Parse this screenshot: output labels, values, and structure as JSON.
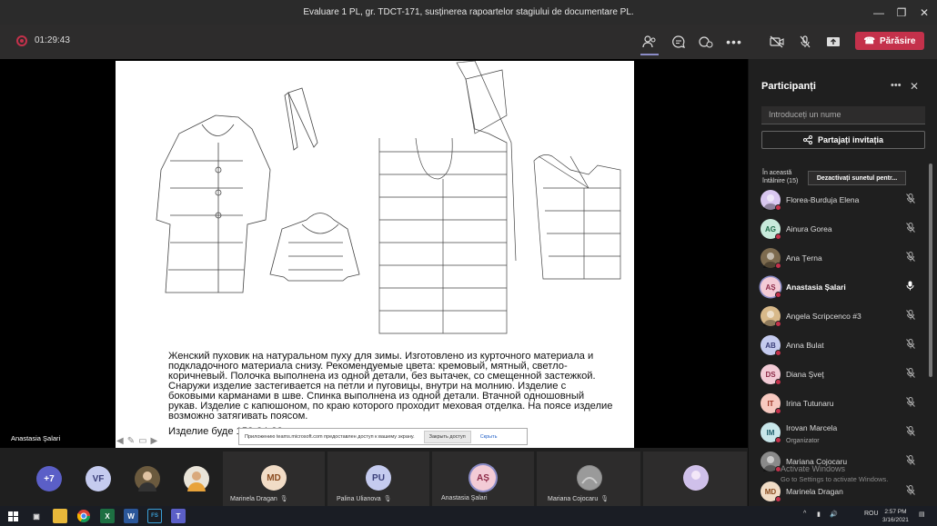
{
  "window": {
    "title": "Evaluare 1 PL, gr. TDCT-171, susținerea rapoartelor stagiului de documentare PL.",
    "minimize": "—",
    "maximize": "❐",
    "close": "✕"
  },
  "callbar": {
    "timer": "01:29:43",
    "leave_label": "Părăsire",
    "icons": [
      "participants-icon",
      "chat-icon",
      "reactions-icon",
      "more-icon",
      "camera-off-icon",
      "mic-off-icon",
      "share-icon"
    ]
  },
  "slide": {
    "text": "Женский пуховик на натуральном пуху для зимы. Изготовлено из курточного материала и подкладочного материала снизу. Рекомендуемые цвета: кремовый, мятный, светло-коричневый. Полочка выполнена из одной детали, без вытачек, со смещенной застежкой. Снаружи изделие застегивается на петли и пуговицы, внутри на молнию. Изделие с боковыми карманами в шве. Спинка выполнена из одной детали. Втачной одношовный рукав. Изделие с капюшоном, по краю которого проходит меховая отделка. На поясе изделие возможно затягивать поясом.",
    "bottom_line": "Изделие буде",
    "bottom_line_tail": "  158-84-88"
  },
  "share_notice": {
    "text": "Приложению teams.microsoft.com предоставлен доступ к вашему экрану.",
    "stop_label": "Закрыть доступ",
    "hide_label": "Скрыть"
  },
  "presenter_name": "Anastasia Şalari",
  "tray": {
    "overflow": "+7",
    "small_avatars": [
      {
        "initials": "VF",
        "color": "#c5cbef",
        "text_color": "#3b3f7a"
      }
    ],
    "tiles": [
      {
        "initials": "MD",
        "name": "Marinela Dragan",
        "color": "#f1dcc6",
        "text_color": "#8a4b1f"
      },
      {
        "initials": "PU",
        "name": "Palina Ulianova",
        "color": "#c5cbef",
        "text_color": "#3b3f7a"
      },
      {
        "initials": "AȘ",
        "name": "Anastasia Şalari",
        "color": "#f3cbd6",
        "text_color": "#8e2c49"
      },
      {
        "initials": "",
        "name": "Mariana Cojocaru",
        "color": "#8a8a8a",
        "text_color": "#fff"
      }
    ]
  },
  "panel": {
    "title": "Participanți",
    "search_placeholder": "Introduceți un nume",
    "share_invite_label": "Partajați invitația",
    "in_meeting_label": "În această întâlnire (15)",
    "mute_all_label": "Dezactivați sunetul pentr...",
    "participants": [
      {
        "name": "Florea-Burduja Elena",
        "initials": "",
        "color": "#d9c7f0",
        "text_color": "#5a3d8a",
        "role": "",
        "bold": false,
        "mic": "mic-off"
      },
      {
        "name": "Ainura Gorea",
        "initials": "AG",
        "color": "#c8eadb",
        "text_color": "#1f6b49",
        "role": "",
        "bold": false,
        "mic": "mic-off"
      },
      {
        "name": "Ana Țerna",
        "initials": "",
        "color": "#7d6b4f",
        "text_color": "#fff",
        "role": "",
        "bold": false,
        "mic": "mic-off"
      },
      {
        "name": "Anastasia Șalari",
        "initials": "AȘ",
        "color": "#f3cbd6",
        "text_color": "#8e2c49",
        "role": "",
        "bold": true,
        "mic": "mic-on"
      },
      {
        "name": "Angela Scripcenco #3",
        "initials": "",
        "color": "#d8b98a",
        "text_color": "#5a3d1f",
        "role": "",
        "bold": false,
        "mic": "mic-off"
      },
      {
        "name": "Anna Bulat",
        "initials": "AB",
        "color": "#c5cbef",
        "text_color": "#3b3f7a",
        "role": "",
        "bold": false,
        "mic": "mic-off"
      },
      {
        "name": "Diana Şveţ",
        "initials": "DS",
        "color": "#f3cbd6",
        "text_color": "#8e2c49",
        "role": "",
        "bold": false,
        "mic": "mic-off"
      },
      {
        "name": "Irina Tutunaru",
        "initials": "IT",
        "color": "#f7c9c0",
        "text_color": "#9a3324",
        "role": "",
        "bold": false,
        "mic": "mic-off"
      },
      {
        "name": "Irovan Marcela",
        "initials": "IM",
        "color": "#c8e6ea",
        "text_color": "#1f5f6b",
        "role": "Organizator",
        "bold": false,
        "mic": "mic-off"
      },
      {
        "name": "Mariana Cojocaru",
        "initials": "",
        "color": "#8a8a8a",
        "text_color": "#fff",
        "role": "",
        "bold": false,
        "mic": "mic-off"
      },
      {
        "name": "Marinela Dragan",
        "initials": "MD",
        "color": "#f1dcc6",
        "text_color": "#8a4b1f",
        "role": "",
        "bold": false,
        "mic": "mic-off"
      }
    ]
  },
  "watermark": {
    "title": "Activate Windows",
    "sub": "Go to Settings to activate Windows."
  },
  "taskbar": {
    "lang": "ROU",
    "time": "2:57 PM",
    "date": "3/16/2021",
    "apps": [
      "windows-start-icon",
      "task-view-icon",
      "file-explorer-icon",
      "chrome-icon",
      "excel-icon",
      "word-icon",
      "fs-app-icon",
      "teams-icon"
    ]
  }
}
